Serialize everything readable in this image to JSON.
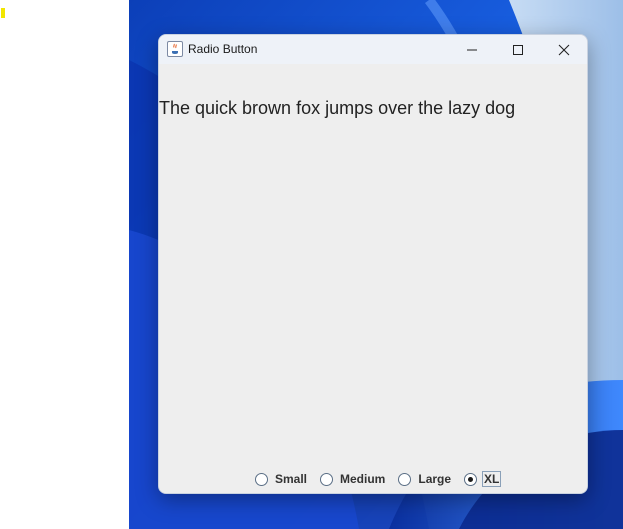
{
  "window": {
    "title": "Radio Button"
  },
  "content": {
    "sample_text": "The quick brown fox jumps over the lazy dog"
  },
  "size_options": {
    "selected": "XL",
    "options": [
      {
        "label": "Small",
        "selected": false
      },
      {
        "label": "Medium",
        "selected": false
      },
      {
        "label": "Large",
        "selected": false
      },
      {
        "label": "XL",
        "selected": true
      }
    ]
  },
  "icons": {
    "app": "java-cup-icon",
    "minimize": "minimize-icon",
    "maximize": "maximize-icon",
    "close": "close-icon"
  },
  "colors": {
    "window_bg": "#eeeeee",
    "titlebar_bg": "#eef2f8",
    "wallpaper_accent": "#1e5fe0"
  }
}
